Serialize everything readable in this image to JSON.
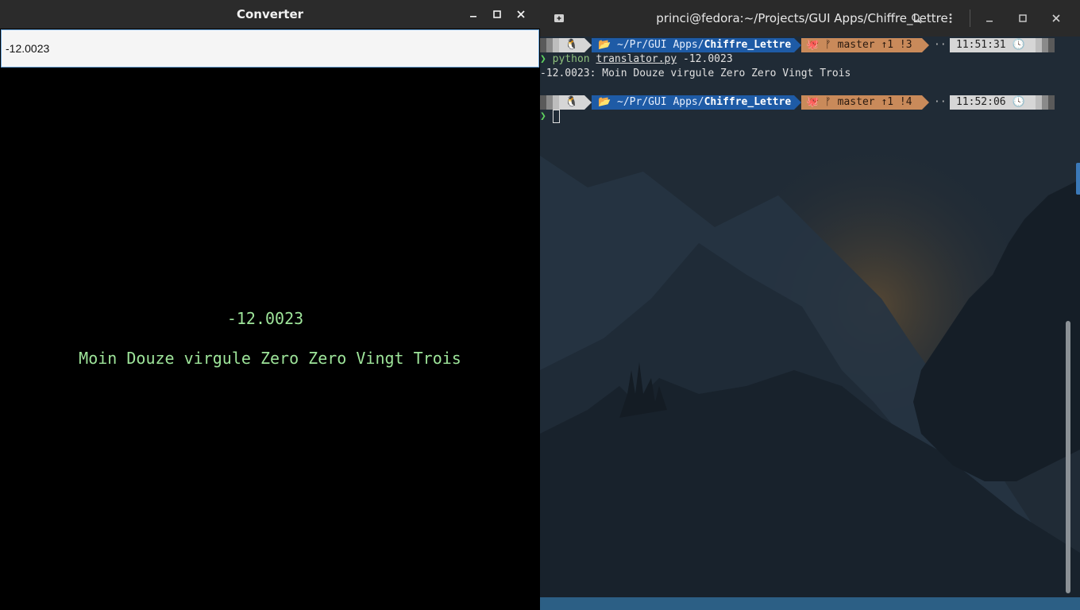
{
  "converter": {
    "title": "Converter",
    "input_value": "-12.0023",
    "number_display": "-12.0023",
    "words_display": "Moin Douze virgule Zero Zero Vingt Trois",
    "text_color": "#9ee59a"
  },
  "terminal": {
    "title": "princi@fedora:~/Projects/GUI Apps/Chiffre_Lettre",
    "prompt1": {
      "path_prefix": "~/Pr/GUI Apps/",
      "path_dir": "Chiffre_Lettre",
      "git": "master ↑1 !3",
      "time": "11:51:31"
    },
    "command": {
      "prompt_char": "❯",
      "program": "python",
      "file": "translator.py",
      "arg": "-12.0023"
    },
    "output": "-12.0023: Moin Douze virgule Zero Zero Vingt Trois",
    "prompt2": {
      "path_prefix": "~/Pr/GUI Apps/",
      "path_dir": "Chiffre_Lettre",
      "git": "master ↑1 !4",
      "time": "11:52:06"
    },
    "prompt_char2": "❯",
    "colors": {
      "path_bg": "#1e5ba6",
      "git_bg": "#c98a5a",
      "prompt": "#5fd35f"
    }
  }
}
